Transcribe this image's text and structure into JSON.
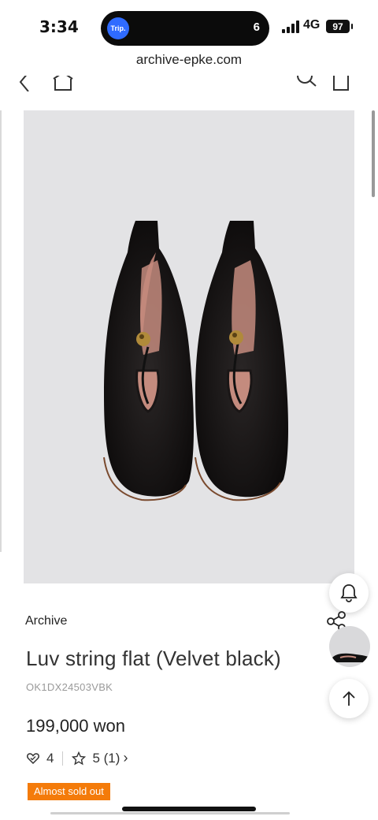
{
  "status": {
    "time": "3:34",
    "trip_label": "Trip.",
    "island_count": "6",
    "network": "4G",
    "battery": "97"
  },
  "browser": {
    "url": "archive-epke.com"
  },
  "product": {
    "brand": "Archive",
    "name": "Luv string flat (Velvet black)",
    "code": "OK1DX24503VBK",
    "price": "199,000 won",
    "likes": "4",
    "rating": "5 (1)",
    "rating_chevron": "›",
    "badge": "Almost sold out"
  },
  "icons": {
    "back": "back-chevron-icon",
    "home": "home-icon",
    "search": "search-icon",
    "bag": "shopping-bag-icon",
    "bell": "bell-icon",
    "share": "share-icon",
    "scroll_top": "arrow-up-icon",
    "heart": "heart-icon",
    "star": "star-icon"
  },
  "colors": {
    "badge": "#f47b0a",
    "image_bg": "#e3e3e5",
    "trip": "#2f6bff"
  }
}
